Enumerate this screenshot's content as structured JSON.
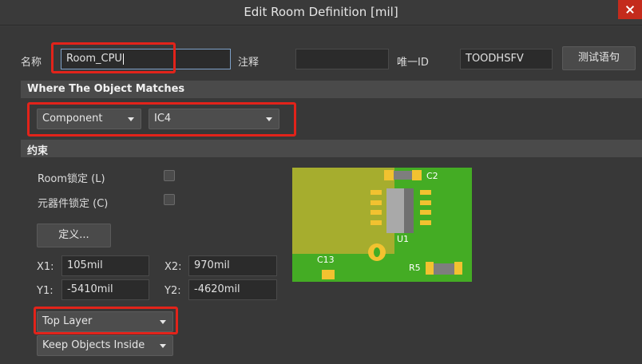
{
  "window": {
    "title": "Edit Room Definition [mil]"
  },
  "header": {
    "name_label": "名称",
    "name_value": "Room_CPU",
    "comment_label": "注释",
    "comment_value": "",
    "uid_label": "唯一ID",
    "uid_value": "TOODHSFV",
    "test_button": "测试语句"
  },
  "match": {
    "section_title": "Where The Object Matches",
    "type_value": "Component",
    "object_value": "IC4"
  },
  "constraints": {
    "section_title": "约束",
    "room_lock_label": "Room锁定 (L)",
    "room_lock_checked": false,
    "component_lock_label": "元器件锁定 (C)",
    "component_lock_checked": false,
    "define_button": "定义...",
    "x1_label": "X1:",
    "x1_value": "105mil",
    "x2_label": "X2:",
    "x2_value": "970mil",
    "y1_label": "Y1:",
    "y1_value": "-5410mil",
    "y2_label": "Y2:",
    "y2_value": "-4620mil",
    "layer_value": "Top Layer",
    "keep_value": "Keep Objects Inside"
  },
  "preview": {
    "designators": {
      "c2": "C2",
      "u1": "U1",
      "c13": "C13",
      "r5": "R5"
    },
    "colors": {
      "board": "#44ac24",
      "room": "#a6ad2e",
      "pad": "#f2c230",
      "body": "#7e7e7e"
    }
  }
}
